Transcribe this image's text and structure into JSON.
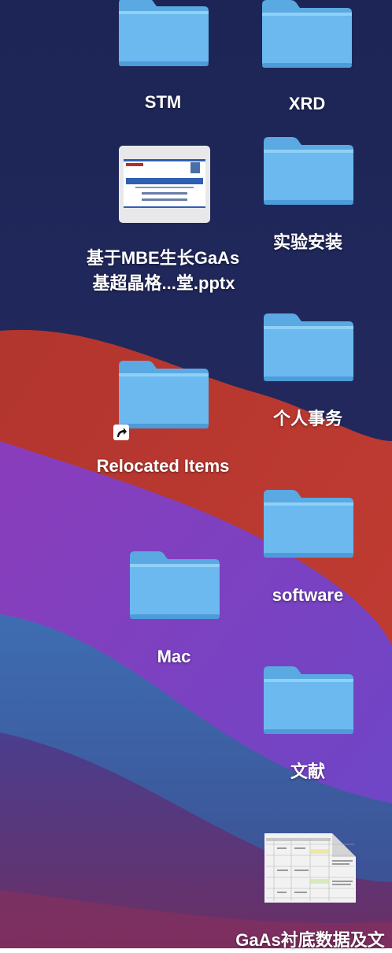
{
  "desktop": {
    "items": [
      {
        "label": "STM",
        "type": "folder"
      },
      {
        "label": "XRD",
        "type": "folder"
      },
      {
        "label_line1": "基于MBE生长GaAs",
        "label_line2": "基超晶格...堂.pptx",
        "type": "pptx-file"
      },
      {
        "label": "实验安装",
        "type": "folder"
      },
      {
        "label": "个人事务",
        "type": "folder"
      },
      {
        "label": "Relocated Items",
        "type": "folder-alias"
      },
      {
        "label": "software",
        "type": "folder"
      },
      {
        "label": "Mac",
        "type": "folder"
      },
      {
        "label": "文献",
        "type": "folder"
      },
      {
        "label": "GaAs衬底数据及文",
        "type": "spreadsheet-file"
      }
    ]
  },
  "colors": {
    "folder_top": "#7cc2f2",
    "folder_body": "#6bb8ee",
    "label_text": "#ffffff"
  }
}
